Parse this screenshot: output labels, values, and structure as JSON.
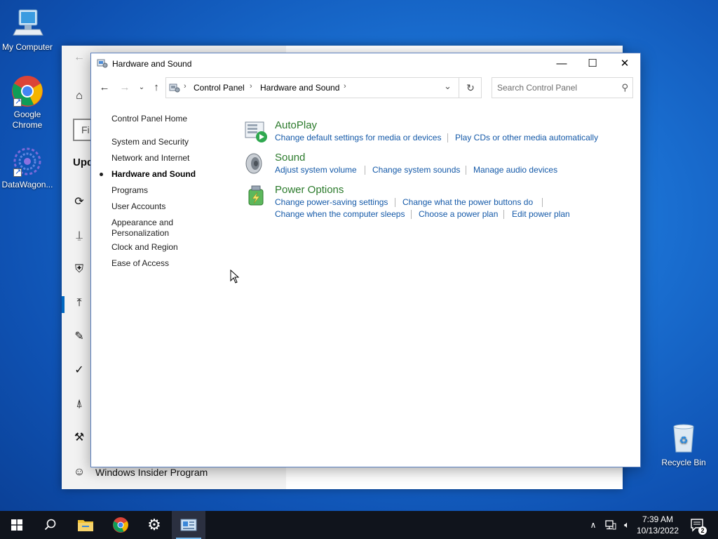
{
  "desktop": {
    "icons": [
      {
        "label": "My Computer"
      },
      {
        "label": "Google Chrome"
      },
      {
        "label": "DataWagon..."
      },
      {
        "label": "Recycle Bin"
      }
    ]
  },
  "settings": {
    "search_partial": "Fi",
    "heading_partial": "Upd",
    "insider_label": "Windows Insider Program",
    "side_icons": [
      "home-icon",
      "sync-icon",
      "delivery-icon",
      "shield-icon",
      "upload-icon",
      "wrench-icon",
      "check-circle-icon",
      "person-location-icon",
      "tools-icon",
      "cat-icon"
    ]
  },
  "window": {
    "title": "Hardware and Sound",
    "controls": {
      "minimize": "—",
      "maximize": "☐",
      "close": "✕"
    }
  },
  "address": {
    "crumbs": [
      "Control Panel",
      "Hardware and Sound"
    ],
    "search_placeholder": "Search Control Panel"
  },
  "nav": {
    "home": "Control Panel Home",
    "items": [
      {
        "label": "System and Security"
      },
      {
        "label": "Network and Internet"
      },
      {
        "label": "Hardware and Sound",
        "active": true
      },
      {
        "label": "Programs"
      },
      {
        "label": "User Accounts"
      },
      {
        "label": "Appearance and Personalization"
      },
      {
        "label": "Clock and Region"
      },
      {
        "label": "Ease of Access"
      }
    ]
  },
  "categories": [
    {
      "title": "AutoPlay",
      "links": [
        "Change default settings for media or devices",
        "Play CDs or other media automatically"
      ]
    },
    {
      "title": "Sound",
      "links": [
        "Adjust system volume",
        "Change system sounds",
        "Manage audio devices"
      ]
    },
    {
      "title": "Power Options",
      "links": [
        "Change power-saving settings",
        "Change what the power buttons do",
        "Change when the computer sleeps",
        "Choose a power plan",
        "Edit power plan"
      ]
    }
  ],
  "taskbar": {
    "apps": [
      "start-icon",
      "search-icon",
      "file-explorer-icon",
      "chrome-icon",
      "settings-gear-icon",
      "control-panel-icon"
    ],
    "clock_time": "7:39 AM",
    "clock_date": "10/13/2022",
    "notification_count": "2"
  },
  "colors": {
    "link": "#1459a8",
    "category_title": "#2b7a2b",
    "taskbar": "#10141c",
    "accent": "#0067c0"
  }
}
